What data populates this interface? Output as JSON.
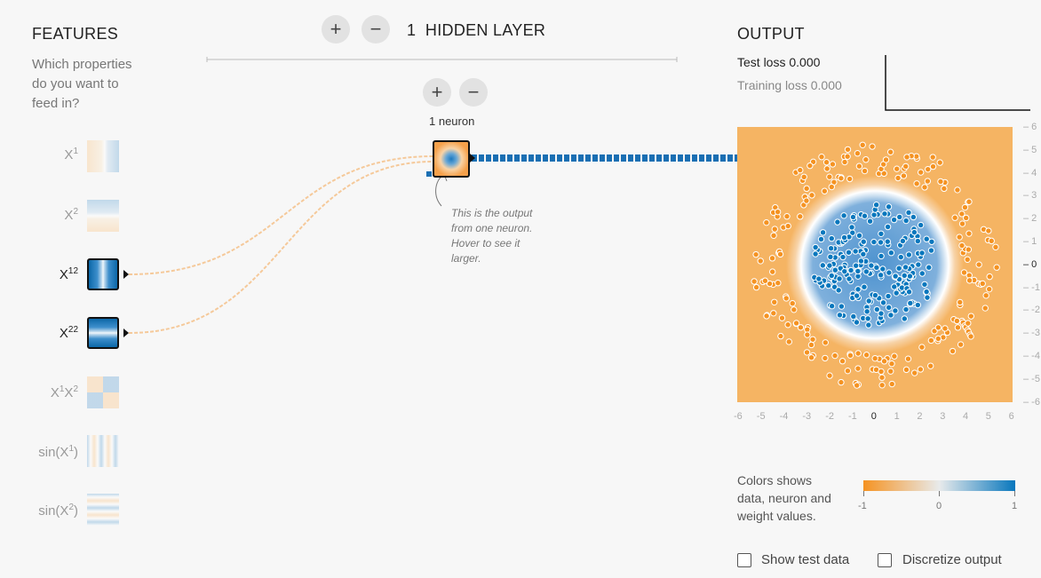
{
  "features": {
    "title": "FEATURES",
    "question_line1": "Which properties",
    "question_line2": "do you want to",
    "question_line3": "feed in?",
    "items": [
      {
        "base": "X",
        "sup": "",
        "sub": "1",
        "rest": "",
        "tail": "",
        "active": false
      },
      {
        "base": "X",
        "sup": "",
        "sub": "2",
        "rest": "",
        "tail": "",
        "active": false
      },
      {
        "base": "X",
        "sup": "2",
        "sub": "1",
        "rest": "",
        "tail": "",
        "active": true
      },
      {
        "base": "X",
        "sup": "2",
        "sub": "2",
        "rest": "",
        "tail": "",
        "active": true
      },
      {
        "base": "X",
        "sup": "",
        "sub": "1",
        "rest": "X",
        "rest_sub": "2",
        "tail": "",
        "active": false
      },
      {
        "base": "sin(X",
        "sup": "",
        "sub": "1",
        "rest": "",
        "tail": ")",
        "active": false
      },
      {
        "base": "sin(X",
        "sup": "",
        "sub": "2",
        "rest": "",
        "tail": ")",
        "active": false
      }
    ]
  },
  "hidden": {
    "layer_count": "1",
    "layer_label": "HIDDEN LAYER",
    "add_layer": "+",
    "remove_layer": "−",
    "add_neuron": "+",
    "remove_neuron": "−",
    "neuron_count_label": "1 neuron",
    "callout_line1": "This is the output",
    "callout_line2": "from one neuron.",
    "callout_line3": "Hover to see it",
    "callout_line4": "larger."
  },
  "output": {
    "title": "OUTPUT",
    "test_loss": "Test loss 0.000",
    "training_loss": "Training loss 0.000",
    "x_ticks": [
      "-6",
      "-5",
      "-4",
      "-3",
      "-2",
      "-1",
      "0",
      "1",
      "2",
      "3",
      "4",
      "5",
      "6"
    ],
    "y_ticks": [
      "6",
      "5",
      "4",
      "3",
      "2",
      "1",
      "0",
      "-1",
      "-2",
      "-3",
      "-4",
      "-5",
      "-6"
    ],
    "legend_text_line1": "Colors shows",
    "legend_text_line2": "data, neuron and",
    "legend_text_line3": "weight values.",
    "legend_min": "-1",
    "legend_mid": "0",
    "legend_max": "1",
    "show_test_data": "Show test data",
    "discretize_output": "Discretize output"
  },
  "colors": {
    "orange": "#f59322",
    "blue": "#0877bd",
    "bg": "#f7f7f7"
  }
}
